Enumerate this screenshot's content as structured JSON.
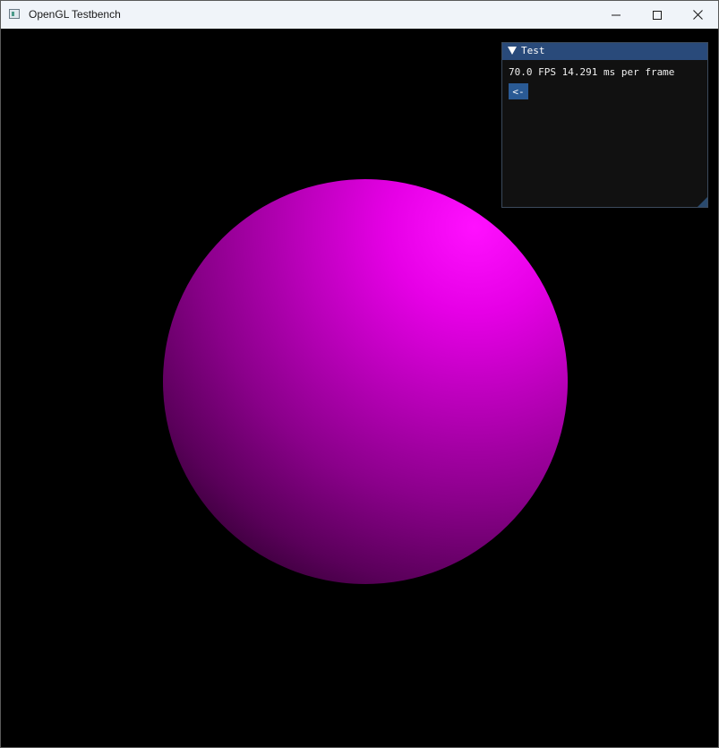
{
  "window": {
    "title": "OpenGL Testbench",
    "controls": {
      "minimize_icon": "minimize-icon",
      "maximize_icon": "maximize-icon",
      "close_icon": "close-icon"
    }
  },
  "scene": {
    "object": "sphere",
    "color": "#ff00ff",
    "background": "#000000"
  },
  "imgui_panel": {
    "title": "Test",
    "collapse_icon": "triangle-down-icon",
    "stats": "70.0 FPS 14.291 ms per frame",
    "back_button_label": "<-",
    "accent_color": "#294a7a",
    "button_color": "#2a5a94"
  }
}
